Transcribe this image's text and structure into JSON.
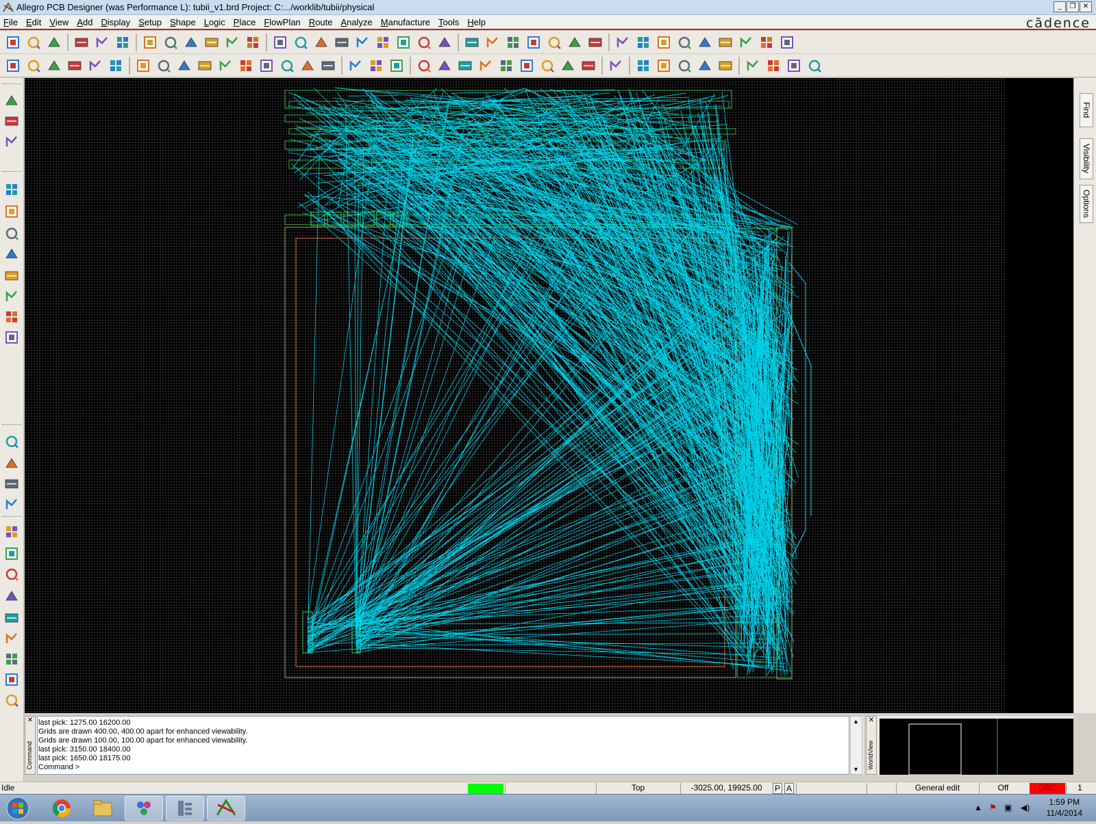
{
  "window": {
    "title": "Allegro PCB Designer (was Performance L): tubii_v1.brd  Project: C:.../worklib/tubii/physical",
    "brand": "cādence",
    "controls": [
      "_",
      "❐",
      "✕"
    ]
  },
  "menu": [
    {
      "acc": "F",
      "rest": "ile"
    },
    {
      "acc": "E",
      "rest": "dit"
    },
    {
      "acc": "V",
      "rest": "iew"
    },
    {
      "acc": "A",
      "rest": "dd"
    },
    {
      "acc": "D",
      "rest": "isplay"
    },
    {
      "acc": "S",
      "rest": "etup"
    },
    {
      "acc": "S",
      "rest": "hape"
    },
    {
      "acc": "L",
      "rest": "ogic"
    },
    {
      "acc": "P",
      "rest": "lace"
    },
    {
      "acc": "F",
      "rest": "lowPlan"
    },
    {
      "acc": "R",
      "rest": "oute"
    },
    {
      "acc": "A",
      "rest": "nalyze"
    },
    {
      "acc": "M",
      "rest": "anufacture"
    },
    {
      "acc": "T",
      "rest": "ools"
    },
    {
      "acc": "H",
      "rest": "elp"
    }
  ],
  "right_tabs": [
    "Find",
    "Visibility",
    "Options"
  ],
  "command": {
    "panel_label": "Command",
    "lines": [
      "last pick:  1275.00  16200.00",
      "Grids are drawn 400.00, 400.00 apart for enhanced viewability.",
      "Grids are drawn 100.00, 100.00 apart for enhanced viewability.",
      "last pick:  3150.00  18400.00",
      "last pick:  1650.00  18175.00",
      "Command >"
    ]
  },
  "worldview": {
    "panel_label": "WorldView"
  },
  "status": {
    "state": "Idle",
    "layer": "Top",
    "coords": "-3025.00, 19925.00",
    "p_btn": "P",
    "a_btn": "A",
    "mode": "General edit",
    "off": "Off",
    "drc": "DRC",
    "count": "1",
    "progress_color": "#00ff00",
    "drc_color": "#ff0000"
  },
  "taskbar": {
    "time": "1:59 PM",
    "date": "11/4/2014"
  },
  "colors": {
    "ratsnest": "#00e5ff",
    "outline": "#c0603a",
    "component": "#3ab54a"
  }
}
